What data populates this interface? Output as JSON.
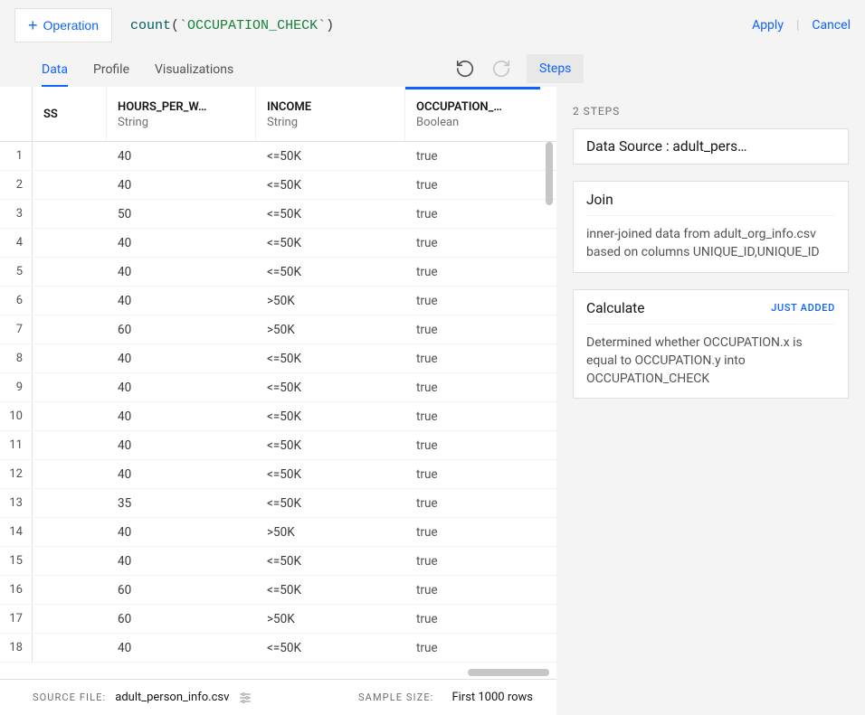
{
  "topbar": {
    "operation_button": "Operation",
    "formula_fn": "count",
    "formula_col": "OCCUPATION_CHECK",
    "apply": "Apply",
    "cancel": "Cancel"
  },
  "nav": {
    "tabs": [
      "Data",
      "Profile",
      "Visualizations"
    ],
    "active_index": 0,
    "steps_button": "Steps"
  },
  "grid": {
    "columns": [
      {
        "name": "SS",
        "type": ""
      },
      {
        "name": "HOURS_PER_W…",
        "type": "String"
      },
      {
        "name": "INCOME",
        "type": "String"
      },
      {
        "name": "OCCUPATION_…",
        "type": "Boolean"
      }
    ],
    "rows": [
      {
        "n": "1",
        "c0": "",
        "c1": "40",
        "c2": "<=50K",
        "c3": "true"
      },
      {
        "n": "2",
        "c0": "",
        "c1": "40",
        "c2": "<=50K",
        "c3": "true"
      },
      {
        "n": "3",
        "c0": "",
        "c1": "50",
        "c2": "<=50K",
        "c3": "true"
      },
      {
        "n": "4",
        "c0": "",
        "c1": "40",
        "c2": "<=50K",
        "c3": "true"
      },
      {
        "n": "5",
        "c0": "",
        "c1": "40",
        "c2": "<=50K",
        "c3": "true"
      },
      {
        "n": "6",
        "c0": "",
        "c1": "40",
        "c2": ">50K",
        "c3": "true"
      },
      {
        "n": "7",
        "c0": "",
        "c1": "60",
        "c2": ">50K",
        "c3": "true"
      },
      {
        "n": "8",
        "c0": "",
        "c1": "40",
        "c2": "<=50K",
        "c3": "true"
      },
      {
        "n": "9",
        "c0": "",
        "c1": "40",
        "c2": "<=50K",
        "c3": "true"
      },
      {
        "n": "10",
        "c0": "",
        "c1": "40",
        "c2": "<=50K",
        "c3": "true"
      },
      {
        "n": "11",
        "c0": "",
        "c1": "40",
        "c2": "<=50K",
        "c3": "true"
      },
      {
        "n": "12",
        "c0": "",
        "c1": "40",
        "c2": "<=50K",
        "c3": "true"
      },
      {
        "n": "13",
        "c0": "",
        "c1": "35",
        "c2": "<=50K",
        "c3": "true"
      },
      {
        "n": "14",
        "c0": "",
        "c1": "40",
        "c2": ">50K",
        "c3": "true"
      },
      {
        "n": "15",
        "c0": "",
        "c1": "40",
        "c2": "<=50K",
        "c3": "true"
      },
      {
        "n": "16",
        "c0": "",
        "c1": "60",
        "c2": "<=50K",
        "c3": "true"
      },
      {
        "n": "17",
        "c0": "",
        "c1": "60",
        "c2": ">50K",
        "c3": "true"
      },
      {
        "n": "18",
        "c0": "",
        "c1": "40",
        "c2": "<=50K",
        "c3": "true"
      }
    ]
  },
  "steps_panel": {
    "count_label": "2 STEPS",
    "cards": [
      {
        "title": "Data Source : adult_pers…",
        "desc": "",
        "badge": ""
      },
      {
        "title": "Join",
        "desc": "inner-joined data from adult_org_info.csv based on columns UNIQUE_ID,UNIQUE_ID",
        "badge": ""
      },
      {
        "title": "Calculate",
        "desc": "Determined whether OCCUPATION.x is equal to OCCUPATION.y into OCCUPATION_CHECK",
        "badge": "JUST ADDED"
      }
    ]
  },
  "footer": {
    "source_label": "SOURCE FILE:",
    "source_value": "adult_person_info.csv",
    "sample_label": "SAMPLE SIZE:",
    "sample_value": "First 1000 rows"
  }
}
